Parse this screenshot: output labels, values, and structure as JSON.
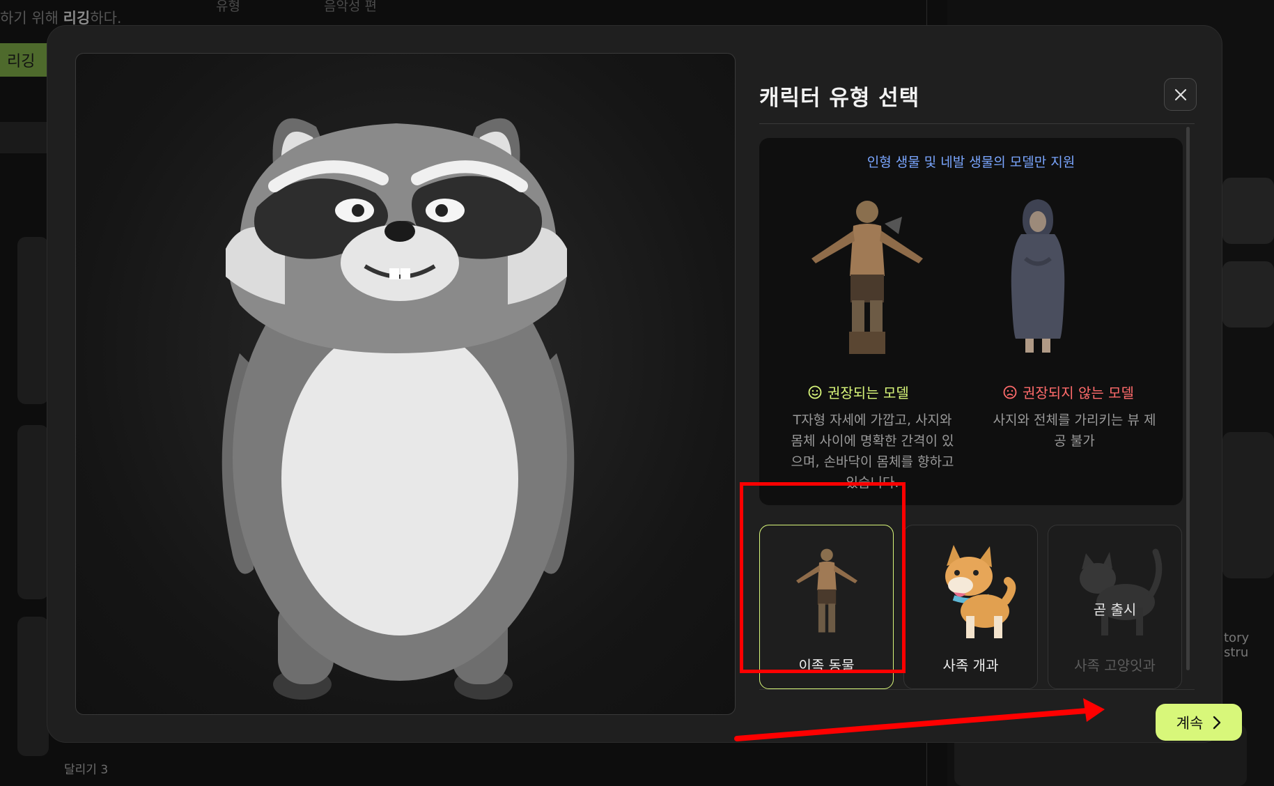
{
  "background": {
    "hint_prefix": "하기 위해",
    "hint_bold": "리깅",
    "hint_suffix": "하다.",
    "tab_label": "리깅",
    "run_label": "달리기 3",
    "top_col1": "유형",
    "top_col2": "음악성 편",
    "right_text": "tory stru"
  },
  "dialog": {
    "title": "캐릭터 유형 선택",
    "close_icon": "close-icon",
    "info": {
      "heading": "인형 생물 및 네발 생물의 모델만 지원",
      "recommended": {
        "label": "권장되는 모델",
        "icon": "smile-icon",
        "description_lines": [
          "T자형 자세에 가깝고, 사지와",
          "몸체 사이에 명확한 간격이 있",
          "으며, 손바닥이 몸체를 향하고",
          "있습니다."
        ]
      },
      "not_recommended": {
        "label": "권장되지 않는 모델",
        "icon": "frown-icon",
        "description_lines": [
          "사지와 전체를 가리키는 뷰 제",
          "공 불가"
        ]
      }
    },
    "types": [
      {
        "label": "이족 동물",
        "selected": true
      },
      {
        "label": "사족 개과",
        "selected": false
      },
      {
        "label": "사족 고양잇과",
        "soon": "곧 출시",
        "disabled": true
      }
    ],
    "continue_label": "계속",
    "colors": {
      "accent": "#d8f77a",
      "link": "#7aa6ff",
      "warn": "#ff6b6b",
      "annotation": "#ff0000"
    }
  }
}
